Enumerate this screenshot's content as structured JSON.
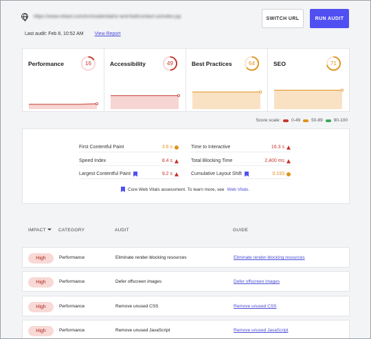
{
  "header": {
    "url": "https://www.reliant.com/en/residential/sr-and-fwd/contact-us/index.jsp",
    "last_audit": "Last audit: Feb 8, 10:52 AM",
    "view_report": "View Report",
    "switch_url": "SWITCH URL",
    "run_audit": "RUN AUDIT"
  },
  "colors": {
    "red": "#c5362e",
    "orange": "#e0911a",
    "green": "#3aa757",
    "accent": "#4f4ff2"
  },
  "scores": [
    {
      "label": "Performance",
      "score": "16",
      "level": 0.16,
      "status": "red",
      "trend": [
        0.14,
        0.14,
        0.14,
        0.14,
        0.16
      ]
    },
    {
      "label": "Accessibility",
      "score": "49",
      "level": 0.49,
      "status": "red",
      "trend": [
        0.49,
        0.49,
        0.49,
        0.49,
        0.49
      ]
    },
    {
      "label": "Best Practices",
      "score": "64",
      "level": 0.64,
      "status": "orange",
      "trend": [
        0.64,
        0.64,
        0.64,
        0.64,
        0.64
      ]
    },
    {
      "label": "SEO",
      "score": "71",
      "level": 0.71,
      "status": "orange",
      "trend": [
        0.71,
        0.71,
        0.71,
        0.71,
        0.71
      ]
    }
  ],
  "scale": {
    "label": "Score scale:",
    "low": "0-49",
    "mid": "50-89",
    "high": "90-100"
  },
  "metrics": {
    "fcp": {
      "name": "First Contentful Paint",
      "value": "3.6 s"
    },
    "si": {
      "name": "Speed Index",
      "value": "8.4 s"
    },
    "lcp": {
      "name": "Largest Contentful Paint",
      "value": "9.2 s"
    },
    "tti": {
      "name": "Time to Interactive",
      "value": "16.3 s"
    },
    "tbt": {
      "name": "Total Blocking Time",
      "value": "2,400 ms"
    },
    "cls": {
      "name": "Cumulative Layout Shift",
      "value": "0.193"
    }
  },
  "cwv_note": "Core Web Vitals assessment. To learn more, see",
  "cwv_link": "Web Vitals.",
  "table": {
    "headers": {
      "impact": "IMPACT",
      "category": "CATEGORY",
      "audit": "AUDIT",
      "guide": "GUIDE"
    },
    "rows": [
      {
        "impact": "High",
        "category": "Performance",
        "audit": "Eliminate render-blocking resources",
        "guide": "Eliminate render-blocking resources"
      },
      {
        "impact": "High",
        "category": "Performance",
        "audit": "Defer offscreen images",
        "guide": "Defer offscreen images"
      },
      {
        "impact": "High",
        "category": "Performance",
        "audit": "Remove unused CSS",
        "guide": "Remove unused CSS"
      },
      {
        "impact": "High",
        "category": "Performance",
        "audit": "Remove unused JavaScript",
        "guide": "Remove unused JavaScript"
      }
    ]
  }
}
